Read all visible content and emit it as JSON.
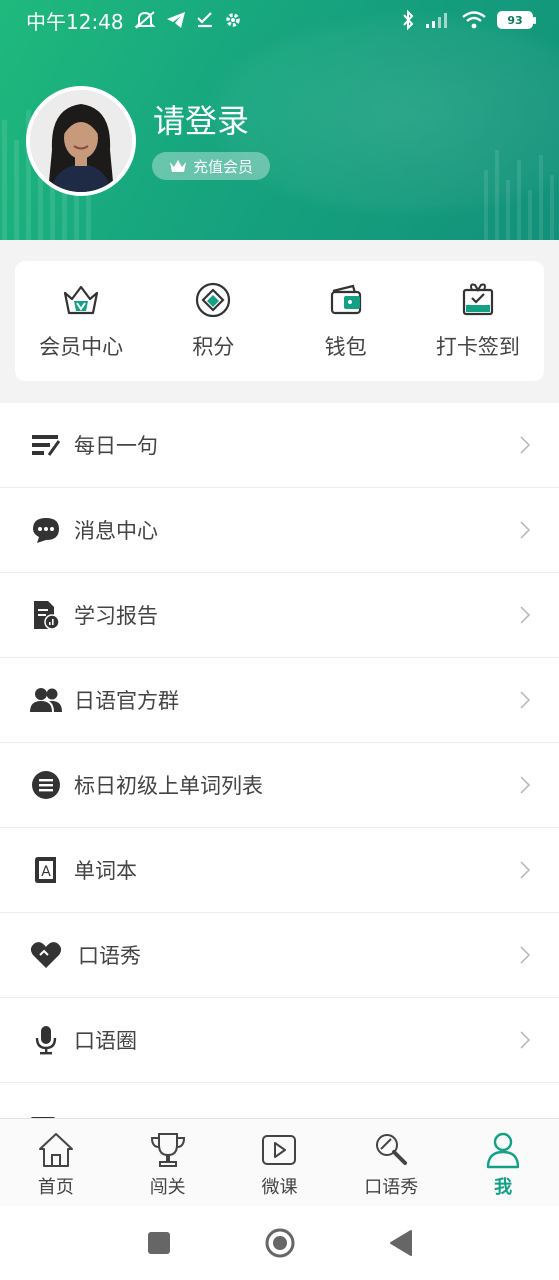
{
  "status_bar": {
    "time": "中午12:48",
    "battery": "93"
  },
  "profile": {
    "title": "请登录",
    "vip_label": "充值会员"
  },
  "quick_actions": [
    {
      "label": "会员中心",
      "icon": "crown-basket-icon"
    },
    {
      "label": "积分",
      "icon": "points-diamond-icon"
    },
    {
      "label": "钱包",
      "icon": "wallet-icon"
    },
    {
      "label": "打卡签到",
      "icon": "checkin-gift-icon"
    }
  ],
  "menu": [
    {
      "label": "每日一句",
      "icon": "daily-sentence-icon"
    },
    {
      "label": "消息中心",
      "icon": "message-bubble-icon"
    },
    {
      "label": "学习报告",
      "icon": "report-document-icon"
    },
    {
      "label": "日语官方群",
      "icon": "group-users-icon"
    },
    {
      "label": "标日初级上单词列表",
      "icon": "list-circle-icon"
    },
    {
      "label": "单词本",
      "icon": "wordbook-icon"
    },
    {
      "label": "口语秀",
      "icon": "heart-icon"
    },
    {
      "label": "口语圈",
      "icon": "microphone-icon"
    }
  ],
  "bottom_nav": [
    {
      "label": "首页",
      "icon": "home-icon",
      "active": false
    },
    {
      "label": "闯关",
      "icon": "trophy-icon",
      "active": false
    },
    {
      "label": "微课",
      "icon": "video-play-icon",
      "active": false
    },
    {
      "label": "口语秀",
      "icon": "search-mic-icon",
      "active": false
    },
    {
      "label": "我",
      "icon": "person-icon",
      "active": true
    }
  ],
  "colors": {
    "accent": "#14a085",
    "header_start": "#1fb97d",
    "header_end": "#12917a"
  }
}
